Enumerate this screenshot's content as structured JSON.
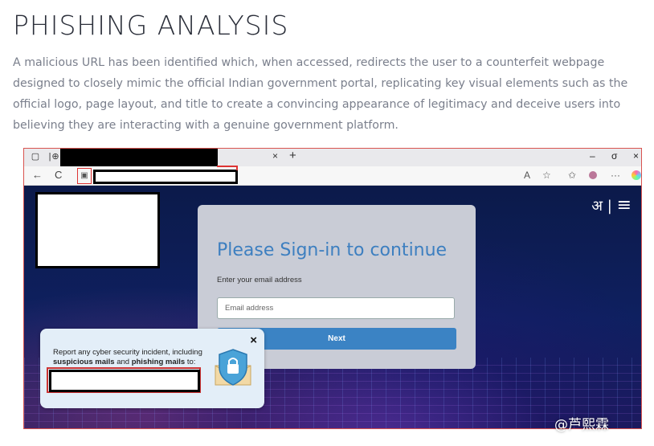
{
  "article": {
    "title": "PHISHING ANALYSIS",
    "intro": "A malicious URL has been identified which, when accessed, redirects the user to a counterfeit webpage designed to closely mimic the official Indian government portal, replicating key visual elements such as the official logo, page layout, and title to create a convincing appearance of legitimacy and deceive users into believing they are interacting with a genuine government platform."
  },
  "browser": {
    "tab_close": "×",
    "new_tab": "+",
    "win_min": "–",
    "win_max": "σ",
    "win_close": "×",
    "back": "←",
    "reload": "C",
    "lock": "🔒",
    "toolbar_aa": "A",
    "toolbar_star": "☆",
    "toolbar_fav": "✩",
    "toolbar_more": "···"
  },
  "page": {
    "lang_toggle": "अ |",
    "menu_icon": "≡",
    "card_title": "Please Sign-in to continue",
    "email_label": "Enter your email address",
    "email_placeholder": "Email address",
    "next_button": "Next"
  },
  "popup": {
    "close": "×",
    "text_plain_1": "Report any cyber security incident, including",
    "text_bold_1": "suspicious mails",
    "text_plain_2": " and ",
    "text_bold_2": "phishing mails",
    "text_plain_3": " to:"
  },
  "watermark": "@芦熙霖"
}
